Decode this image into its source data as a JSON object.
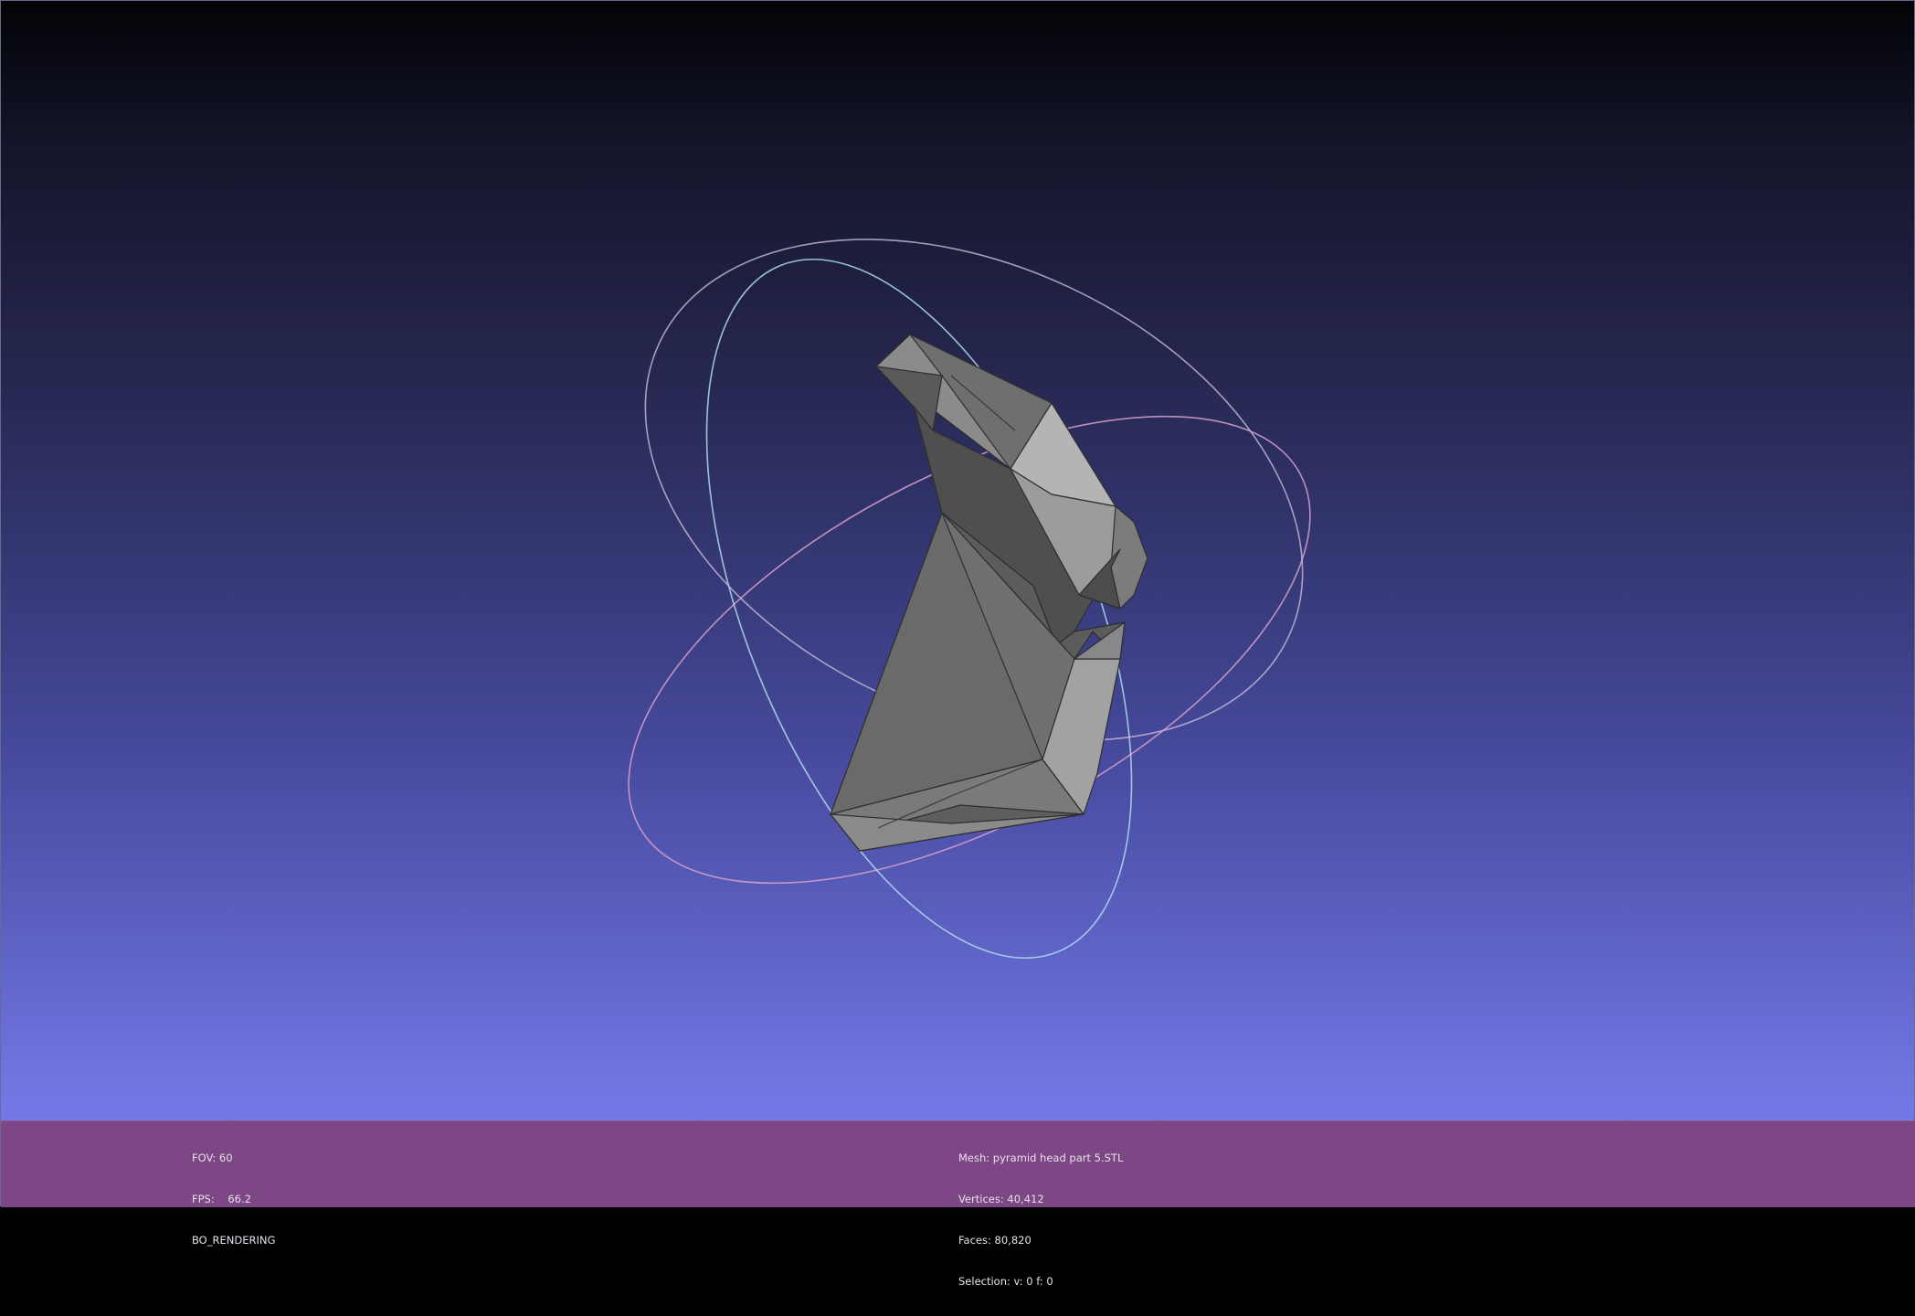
{
  "viewport": {
    "background_top": "#030306",
    "background_bottom": "#7a7eea",
    "mesh_color": "#8e8e8e",
    "trackball_colors": [
      "#b8e0f0",
      "#e8a8d8",
      "#c8c0d8"
    ]
  },
  "status_left": {
    "fov": "FOV: 60",
    "fps": "FPS:    66.2",
    "mode": "BO_RENDERING"
  },
  "status_right": {
    "mesh": "Mesh: pyramid head part 5.STL",
    "vertices": "Vertices: 40,412",
    "faces": "Faces: 80,820",
    "selection": "Selection: v: 0 f: 0"
  },
  "info_bar_color": "#7d4785"
}
